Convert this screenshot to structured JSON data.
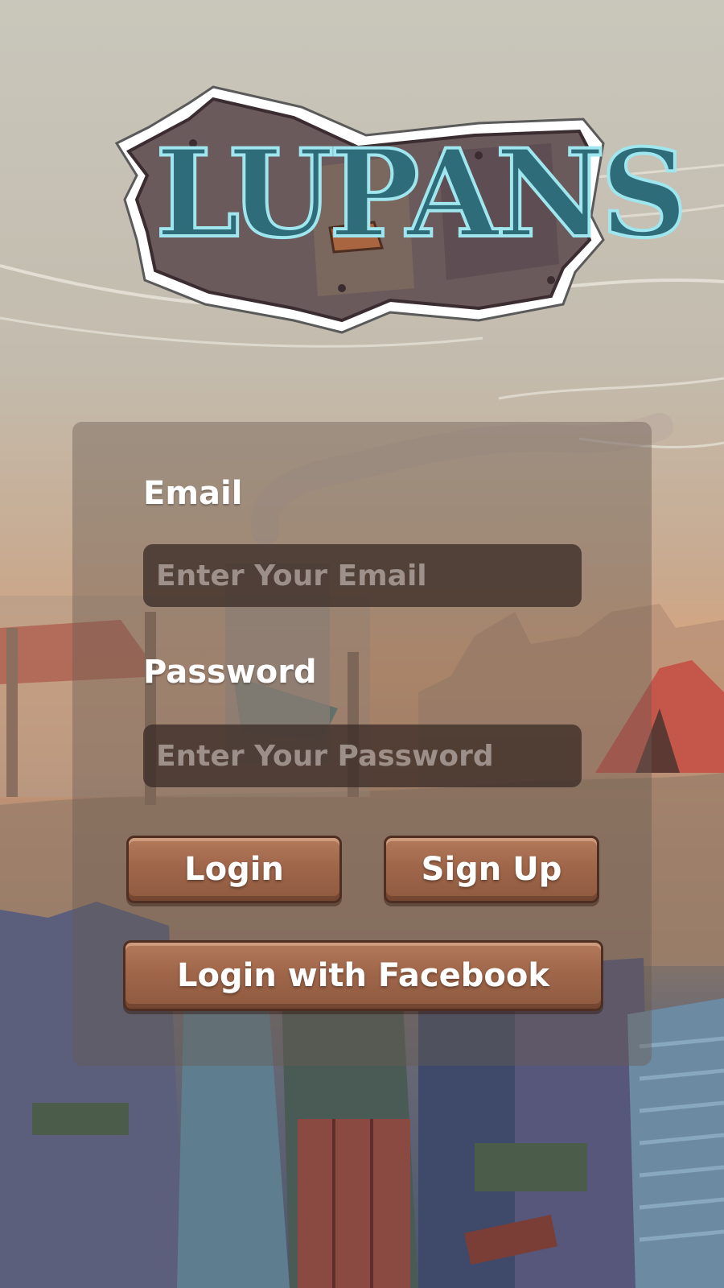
{
  "app": {
    "logo_text": "LUPANS"
  },
  "login_form": {
    "email_label": "Email",
    "email_placeholder": "Enter Your Email",
    "password_label": "Password",
    "password_placeholder": "Enter Your Password",
    "login_label": "Login",
    "signup_label": "Sign Up",
    "facebook_label": "Login with Facebook"
  },
  "colors": {
    "wood_button": "#a0664a",
    "logo_text": "#2e6c7a",
    "logo_glow": "#9fe6ee",
    "input_bg": "#3c2d28"
  }
}
